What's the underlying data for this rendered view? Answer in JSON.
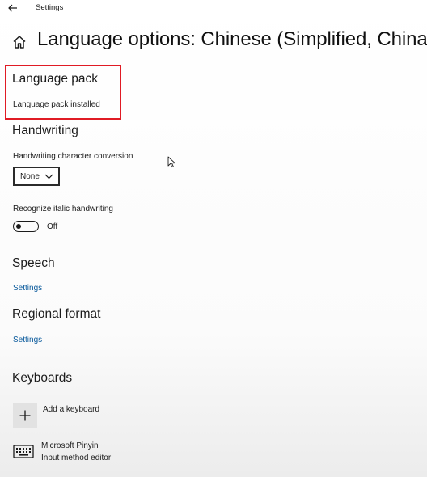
{
  "window": {
    "title": "Settings"
  },
  "page": {
    "title": "Language options: Chinese (Simplified, China)"
  },
  "language_pack": {
    "heading": "Language pack",
    "status": "Language pack installed"
  },
  "handwriting": {
    "heading": "Handwriting",
    "conversion_label": "Handwriting character conversion",
    "conversion_value": "None",
    "italic_label": "Recognize italic handwriting",
    "italic_state": "Off"
  },
  "speech": {
    "heading": "Speech",
    "settings_link": "Settings"
  },
  "regional_format": {
    "heading": "Regional format",
    "settings_link": "Settings"
  },
  "keyboards": {
    "heading": "Keyboards",
    "add_label": "Add a keyboard",
    "items": [
      {
        "name": "Microsoft Pinyin",
        "type": "Input method editor"
      }
    ]
  },
  "colors": {
    "highlight": "#e01b24",
    "link": "#0a5a9c"
  },
  "icons": [
    "back-arrow-icon",
    "home-icon",
    "chevron-down-icon",
    "plus-icon",
    "keyboard-icon",
    "mouse-pointer-icon"
  ]
}
